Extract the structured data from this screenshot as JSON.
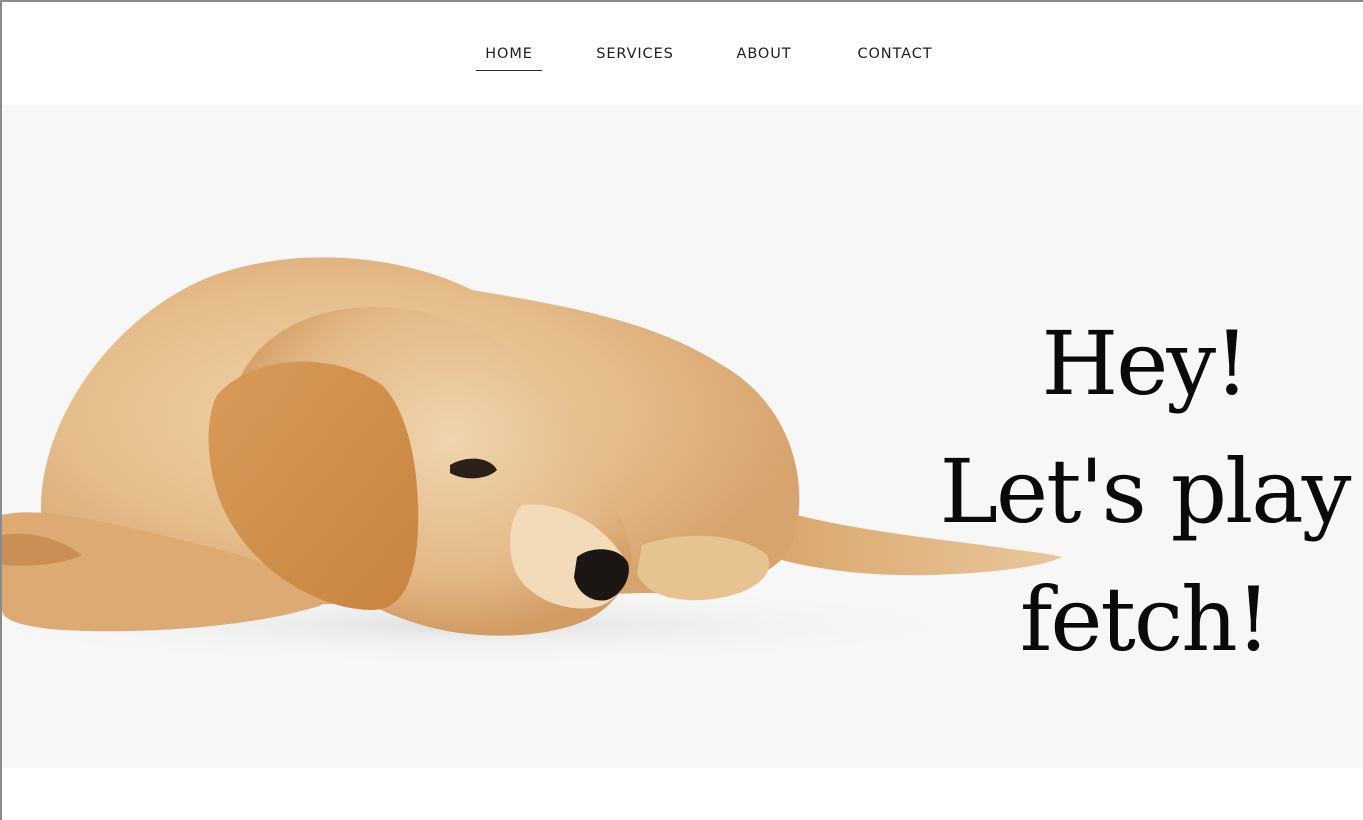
{
  "nav": {
    "items": [
      {
        "label": "HOME",
        "active": true
      },
      {
        "label": "SERVICES",
        "active": false
      },
      {
        "label": "ABOUT",
        "active": false
      },
      {
        "label": "CONTACT",
        "active": false
      }
    ]
  },
  "hero": {
    "headline_lines": [
      "Hey!",
      "Let's play",
      "fetch!"
    ],
    "image": "golden-retriever-puppy-lying-down"
  },
  "colors": {
    "hero_background": "#f7f7f7",
    "text": "#0a0a0a",
    "fur": "#e0b07a"
  }
}
